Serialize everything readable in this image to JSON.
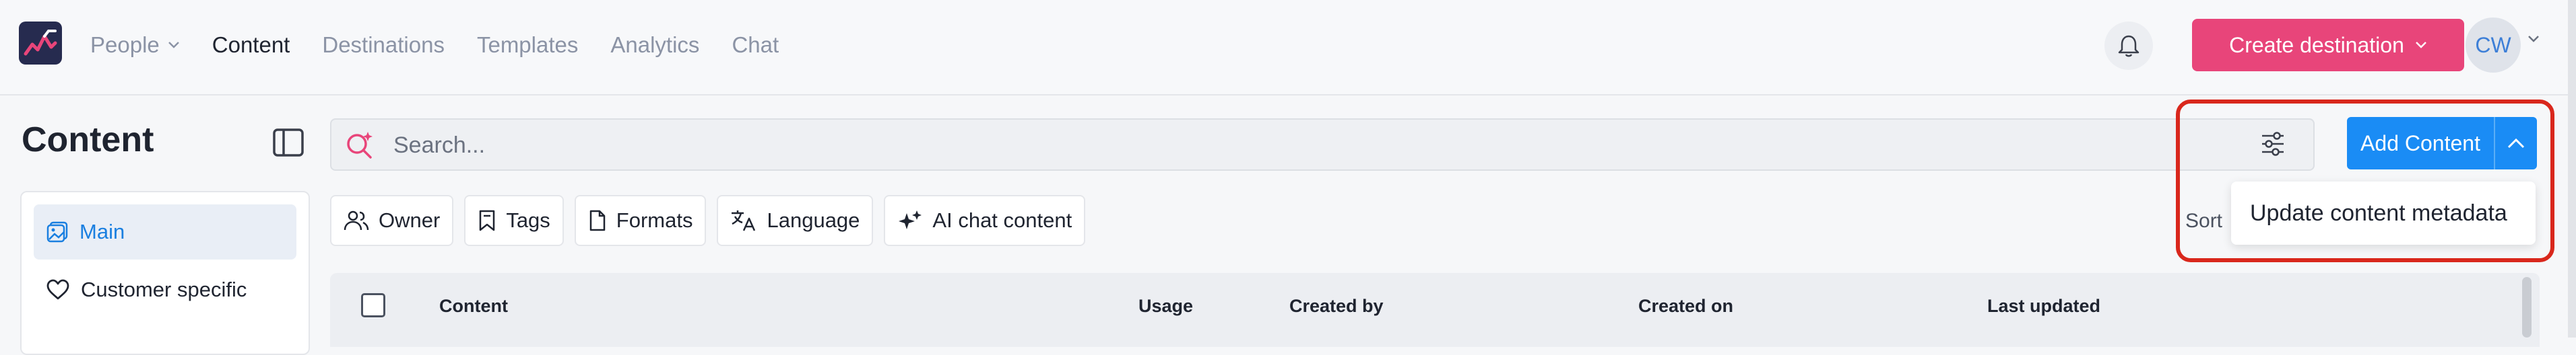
{
  "topbar": {
    "nav": [
      {
        "label": "People",
        "has_caret": true
      },
      {
        "label": "Content",
        "active": true
      },
      {
        "label": "Destinations"
      },
      {
        "label": "Templates"
      },
      {
        "label": "Analytics"
      },
      {
        "label": "Chat"
      }
    ],
    "create_button_label": "Create destination",
    "avatar_initials": "CW"
  },
  "page": {
    "title": "Content"
  },
  "search": {
    "placeholder": "Search..."
  },
  "actions": {
    "add_content_label": "Add Content",
    "dropdown_item": "Update content metadata"
  },
  "sidebar": {
    "items": [
      {
        "label": "Main",
        "icon": "image-icon",
        "active": true
      },
      {
        "label": "Customer specific",
        "icon": "heart-icon"
      }
    ]
  },
  "filters": {
    "chips": [
      {
        "label": "Owner",
        "icon": "users-icon"
      },
      {
        "label": "Tags",
        "icon": "bookmark-icon"
      },
      {
        "label": "Formats",
        "icon": "file-icon"
      },
      {
        "label": "Language",
        "icon": "translate-icon"
      },
      {
        "label": "AI chat content",
        "icon": "sparkle-icon"
      }
    ],
    "sort_label": "Sort"
  },
  "table": {
    "columns": [
      "Content",
      "Usage",
      "Created by",
      "Created on",
      "Last updated"
    ]
  },
  "colors": {
    "brand_pink": "#e8457a",
    "primary_blue": "#1a8cf5",
    "highlight_red": "#d9271c"
  }
}
